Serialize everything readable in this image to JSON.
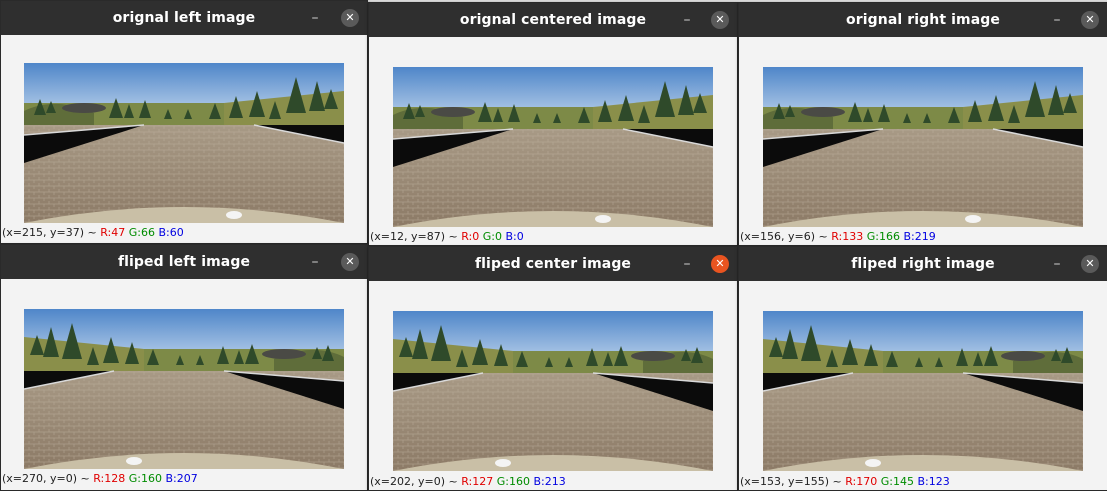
{
  "windows": [
    {
      "title": "orignal left image",
      "coords": "(x=215, y=37) ~ ",
      "r": "R:47",
      "g": "G:66",
      "b": "B:60"
    },
    {
      "title": "orignal centered image",
      "coords": "(x=12, y=87) ~ ",
      "r": "R:0",
      "g": "G:0",
      "b": "B:0"
    },
    {
      "title": "orignal right image",
      "coords": "(x=156, y=6) ~ ",
      "r": "R:133",
      "g": "G:166",
      "b": "B:219"
    },
    {
      "title": "fliped left image",
      "coords": "(x=270, y=0) ~ ",
      "r": "R:128",
      "g": "G:160",
      "b": "B:207"
    },
    {
      "title": "fliped center image",
      "coords": "(x=202, y=0) ~ ",
      "r": "R:127",
      "g": "G:160",
      "b": "B:213"
    },
    {
      "title": "fliped right image",
      "coords": "(x=153, y=155) ~ ",
      "r": "R:170",
      "g": "G:145",
      "b": "B:123"
    }
  ],
  "controls": {
    "minimize": "–",
    "close": "✕"
  },
  "colors": {
    "titlebar": "#2f2f2f",
    "close_active": "#e95420",
    "r": "#e00000",
    "g": "#008c00",
    "b": "#0000e0"
  }
}
